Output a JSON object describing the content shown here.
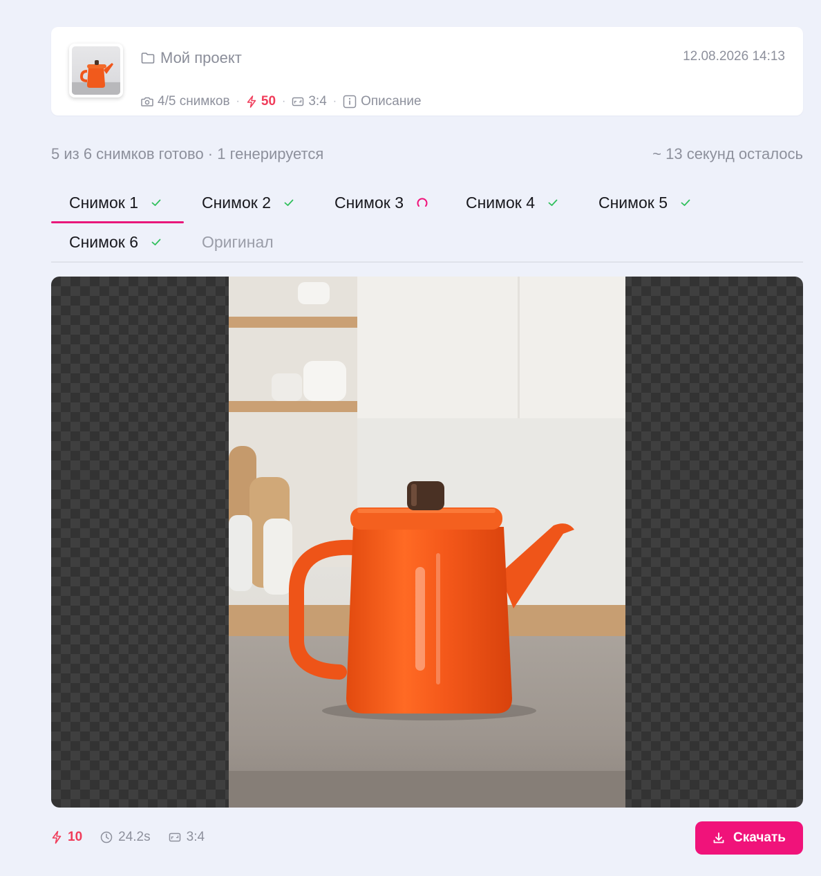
{
  "project": {
    "title": "Мой проект",
    "shots": "4/5 снимков",
    "credits": "50",
    "ratio": "3:4",
    "description": "Описание",
    "date": "12.08.2026 14:13"
  },
  "status": {
    "progress": "5 из 6 снимков готово · 1 генерируется",
    "remaining": "~ 13 секунд осталось"
  },
  "tabs": [
    {
      "label": "Снимок 1",
      "state": "done"
    },
    {
      "label": "Снимок 2",
      "state": "done"
    },
    {
      "label": "Снимок 3",
      "state": "loading"
    },
    {
      "label": "Снимок 4",
      "state": "done"
    },
    {
      "label": "Снимок 5",
      "state": "done"
    },
    {
      "label": "Снимок 6",
      "state": "done"
    },
    {
      "label": "Оригинал",
      "state": "none"
    }
  ],
  "footer": {
    "credits": "10",
    "time": "24.2s",
    "ratio": "3:4",
    "download_label": "Скачать"
  },
  "colors": {
    "accent": "#f0137a",
    "credits": "#f03c5a",
    "success": "#2fbf5b"
  }
}
